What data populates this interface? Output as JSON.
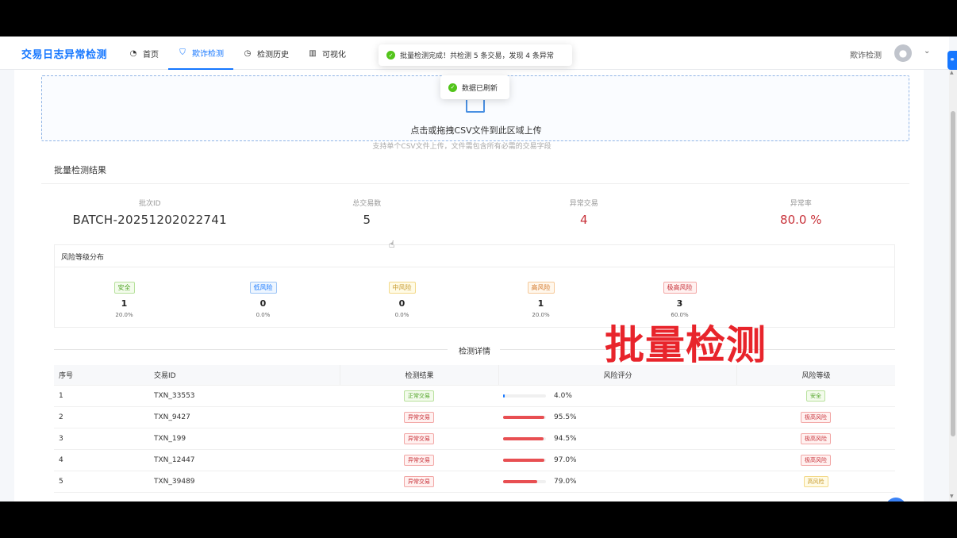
{
  "header": {
    "logo": "交易日志异常检测",
    "nav": [
      {
        "label": "首页",
        "icon": "dashboard-icon",
        "glyph": "◔"
      },
      {
        "label": "欺诈检测",
        "icon": "shield-icon",
        "glyph": "⛉"
      },
      {
        "label": "检测历史",
        "icon": "clock-icon",
        "glyph": "◷"
      },
      {
        "label": "可视化",
        "icon": "chart-icon",
        "glyph": "▥"
      }
    ],
    "active_tab": "欺诈检测",
    "user_name": "欺诈检测"
  },
  "toasts": {
    "batch_done": "批量检测完成！共检测 5 条交易，发现 4 条异常",
    "refreshed": "数据已刷新"
  },
  "upload": {
    "text": "点击或拖拽CSV文件到此区域上传",
    "hint": "支持单个CSV文件上传，文件需包含所有必需的交易字段"
  },
  "results": {
    "title": "批量检测结果",
    "stats": [
      {
        "label": "批次ID",
        "value": "BATCH-20251202022741"
      },
      {
        "label": "总交易数",
        "value": "5"
      },
      {
        "label": "异常交易",
        "value": "4"
      },
      {
        "label": "异常率",
        "value": "80.0 %"
      }
    ],
    "risk": {
      "title": "风险等级分布",
      "items": [
        {
          "label": "安全",
          "count": "1",
          "pct": "20.0%",
          "color": "#52a529",
          "bg": "#f3fbec",
          "border": "#b7e19c"
        },
        {
          "label": "低风险",
          "count": "0",
          "pct": "0.0%",
          "color": "#1677ff",
          "bg": "#eef6ff",
          "border": "#9ec5f5"
        },
        {
          "label": "中风险",
          "count": "0",
          "pct": "0.0%",
          "color": "#c79a2e",
          "bg": "#fffbe6",
          "border": "#f3d98a"
        },
        {
          "label": "高风险",
          "count": "1",
          "pct": "20.0%",
          "color": "#d4792c",
          "bg": "#fff7ec",
          "border": "#f5c99a"
        },
        {
          "label": "极高风险",
          "count": "3",
          "pct": "60.0%",
          "color": "#c8323a",
          "bg": "#fff1f0",
          "border": "#f2a7a6"
        }
      ]
    }
  },
  "details": {
    "title": "检测详情",
    "columns": [
      "序号",
      "交易ID",
      "检测结果",
      "风险评分",
      "风险等级"
    ],
    "rows": [
      {
        "no": "1",
        "id": "TXN_33553",
        "result": "正常交易",
        "score": 0.04,
        "score_text": "4.0%",
        "level": "安全"
      },
      {
        "no": "2",
        "id": "TXN_9427",
        "result": "异常交易",
        "score": 0.955,
        "score_text": "95.5%",
        "level": "极高风险"
      },
      {
        "no": "3",
        "id": "TXN_199",
        "result": "异常交易",
        "score": 0.945,
        "score_text": "94.5%",
        "level": "极高风险"
      },
      {
        "no": "4",
        "id": "TXN_12447",
        "result": "异常交易",
        "score": 0.97,
        "score_text": "97.0%",
        "level": "极高风险"
      },
      {
        "no": "5",
        "id": "TXN_39489",
        "result": "异常交易",
        "score": 0.79,
        "score_text": "79.0%",
        "level": "高风险"
      }
    ]
  },
  "overlay_caption": "批量检测",
  "colors": {
    "accent": "#1677ff",
    "danger": "#c8323a",
    "bar_low": "#1677ff",
    "bar_high": "#e84f52"
  }
}
